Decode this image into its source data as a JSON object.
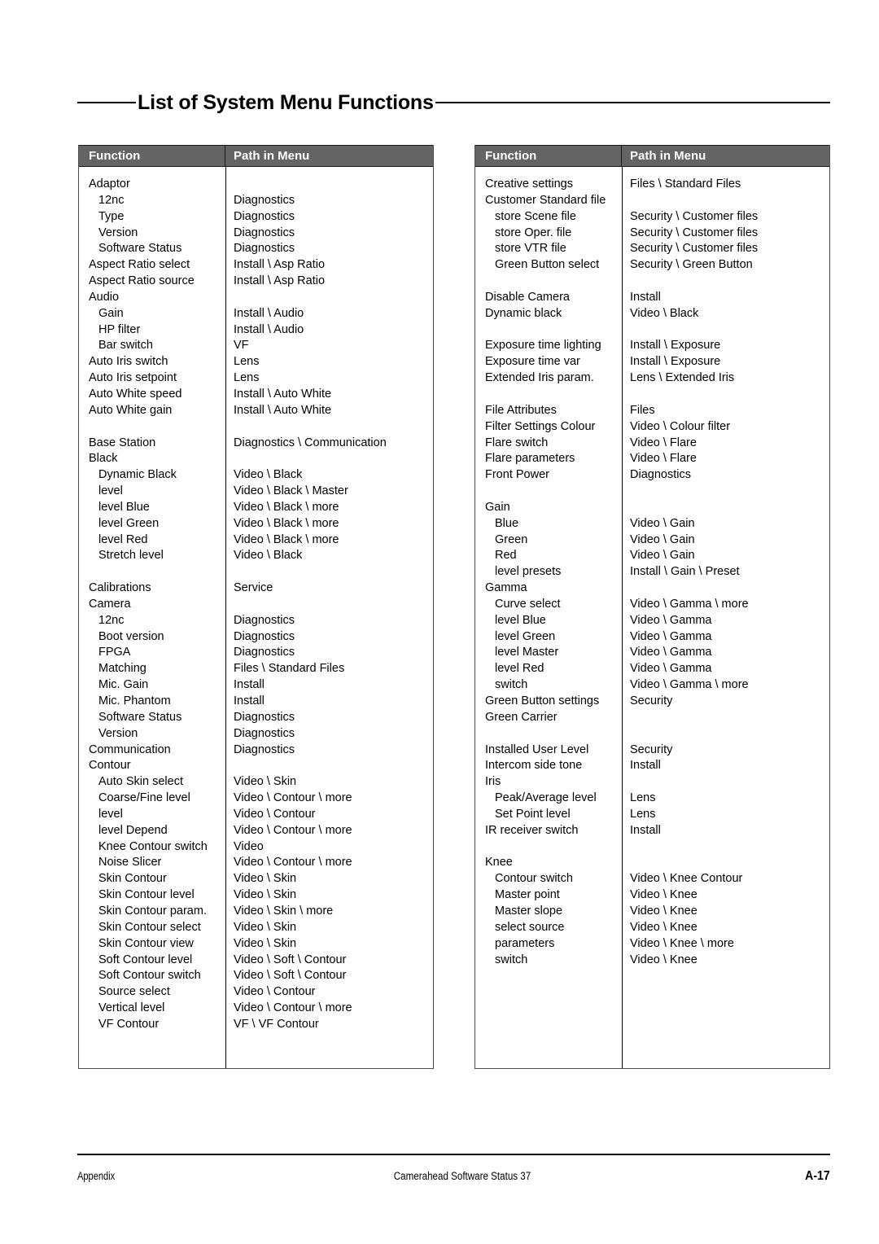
{
  "page": {
    "title": "List of System Menu Functions"
  },
  "table_headers": {
    "function": "Function",
    "path": "Path in Menu"
  },
  "left_table": {
    "rows": [
      {
        "func": "Adaptor",
        "path": "",
        "indent": false
      },
      {
        "func": "12nc",
        "path": "Diagnostics",
        "indent": true
      },
      {
        "func": "Type",
        "path": "Diagnostics",
        "indent": true
      },
      {
        "func": "Version",
        "path": "Diagnostics",
        "indent": true
      },
      {
        "func": "Software Status",
        "path": "Diagnostics",
        "indent": true
      },
      {
        "func": "Aspect Ratio select",
        "path": "Install \\  Asp Ratio",
        "indent": false
      },
      {
        "func": "Aspect Ratio source",
        "path": "Install \\  Asp Ratio",
        "indent": false
      },
      {
        "func": "Audio",
        "path": "",
        "indent": false
      },
      {
        "func": "Gain",
        "path": "Install \\ Audio",
        "indent": true
      },
      {
        "func": "HP filter",
        "path": "Install \\ Audio",
        "indent": true
      },
      {
        "func": "Bar switch",
        "path": "VF",
        "indent": true
      },
      {
        "func": "Auto Iris switch",
        "path": "Lens",
        "indent": false
      },
      {
        "func": "Auto Iris setpoint",
        "path": "Lens",
        "indent": false
      },
      {
        "func": "Auto White speed",
        "path": "Install \\ Auto White",
        "indent": false
      },
      {
        "func": "Auto White gain",
        "path": "Install \\ Auto White",
        "indent": false
      },
      {
        "func": "",
        "path": "",
        "indent": false
      },
      {
        "func": "Base Station",
        "path": "Diagnostics \\ Communication",
        "indent": false
      },
      {
        "func": "Black",
        "path": "",
        "indent": false
      },
      {
        "func": "Dynamic Black",
        "path": "Video \\ Black",
        "indent": true
      },
      {
        "func": "level",
        "path": "Video \\ Black \\ Master",
        "indent": true
      },
      {
        "func": "level Blue",
        "path": "Video \\ Black \\ more",
        "indent": true
      },
      {
        "func": "level Green",
        "path": "Video \\ Black \\ more",
        "indent": true
      },
      {
        "func": "level Red",
        "path": "Video \\ Black \\ more",
        "indent": true
      },
      {
        "func": "Stretch level",
        "path": "Video \\ Black",
        "indent": true
      },
      {
        "func": "",
        "path": "",
        "indent": false
      },
      {
        "func": "Calibrations",
        "path": "Service",
        "indent": false
      },
      {
        "func": "Camera",
        "path": "",
        "indent": false
      },
      {
        "func": "12nc",
        "path": "Diagnostics",
        "indent": true
      },
      {
        "func": "Boot version",
        "path": "Diagnostics",
        "indent": true
      },
      {
        "func": "FPGA",
        "path": "Diagnostics",
        "indent": true
      },
      {
        "func": "Matching",
        "path": "Files \\ Standard Files",
        "indent": true
      },
      {
        "func": "Mic. Gain",
        "path": "Install",
        "indent": true
      },
      {
        "func": "Mic. Phantom",
        "path": "Install",
        "indent": true
      },
      {
        "func": "Software Status",
        "path": "Diagnostics",
        "indent": true
      },
      {
        "func": "Version",
        "path": "Diagnostics",
        "indent": true
      },
      {
        "func": "Communication",
        "path": "Diagnostics",
        "indent": false
      },
      {
        "func": "Contour",
        "path": "",
        "indent": false
      },
      {
        "func": "Auto Skin select",
        "path": "Video \\ Skin",
        "indent": true
      },
      {
        "func": "Coarse/Fine level",
        "path": "Video \\ Contour \\ more",
        "indent": true
      },
      {
        "func": "level",
        "path": "Video \\ Contour",
        "indent": true
      },
      {
        "func": "level Depend",
        "path": "Video \\ Contour \\ more",
        "indent": true
      },
      {
        "func": "Knee Contour switch",
        "path": "Video",
        "indent": true
      },
      {
        "func": "Noise Slicer",
        "path": "Video \\ Contour \\ more",
        "indent": true
      },
      {
        "func": "Skin Contour",
        "path": "Video \\ Skin",
        "indent": true
      },
      {
        "func": "Skin Contour level",
        "path": "Video \\ Skin",
        "indent": true
      },
      {
        "func": "Skin Contour param.",
        "path": "Video \\ Skin \\ more",
        "indent": true
      },
      {
        "func": "Skin Contour select",
        "path": "Video \\ Skin",
        "indent": true
      },
      {
        "func": "Skin Contour view",
        "path": "Video \\ Skin",
        "indent": true
      },
      {
        "func": "Soft Contour level",
        "path": "Video \\ Soft \\ Contour",
        "indent": true
      },
      {
        "func": "Soft Contour switch",
        "path": "Video \\ Soft \\ Contour",
        "indent": true
      },
      {
        "func": "Source select",
        "path": "Video \\ Contour",
        "indent": true
      },
      {
        "func": "Vertical level",
        "path": "Video \\ Contour \\ more",
        "indent": true
      },
      {
        "func": "VF Contour",
        "path": "VF \\ VF Contour",
        "indent": true
      }
    ]
  },
  "right_table": {
    "rows": [
      {
        "func": "Creative settings",
        "path": "Files \\ Standard Files",
        "indent": false
      },
      {
        "func": "Customer Standard file",
        "path": "",
        "indent": false
      },
      {
        "func": "store Scene file",
        "path": "Security \\ Customer files",
        "indent": true
      },
      {
        "func": "store Oper. file",
        "path": "Security \\ Customer files",
        "indent": true
      },
      {
        "func": "store VTR file",
        "path": "Security \\ Customer files",
        "indent": true
      },
      {
        "func": "Green Button select",
        "path": "Security \\ Green Button",
        "indent": true
      },
      {
        "func": "",
        "path": "",
        "indent": false
      },
      {
        "func": "Disable Camera",
        "path": "Install",
        "indent": false
      },
      {
        "func": "Dynamic black",
        "path": "Video \\ Black",
        "indent": false
      },
      {
        "func": "",
        "path": "",
        "indent": false
      },
      {
        "func": "Exposure time lighting",
        "path": "Install \\ Exposure",
        "indent": false
      },
      {
        "func": "Exposure time var",
        "path": "Install \\ Exposure",
        "indent": false
      },
      {
        "func": "Extended Iris param.",
        "path": "Lens \\ Extended Iris",
        "indent": false
      },
      {
        "func": "",
        "path": "",
        "indent": false
      },
      {
        "func": "File Attributes",
        "path": "Files",
        "indent": false
      },
      {
        "func": "Filter Settings Colour",
        "path": "Video \\ Colour filter",
        "indent": false
      },
      {
        "func": "Flare switch",
        "path": "Video \\ Flare",
        "indent": false
      },
      {
        "func": "Flare parameters",
        "path": "Video \\ Flare",
        "indent": false
      },
      {
        "func": "Front Power",
        "path": "Diagnostics",
        "indent": false
      },
      {
        "func": "",
        "path": "",
        "indent": false
      },
      {
        "func": "Gain",
        "path": "",
        "indent": false
      },
      {
        "func": "Blue",
        "path": "Video \\ Gain",
        "indent": true
      },
      {
        "func": "Green",
        "path": "Video \\ Gain",
        "indent": true
      },
      {
        "func": "Red",
        "path": "Video \\ Gain",
        "indent": true
      },
      {
        "func": "level presets",
        "path": "Install \\ Gain \\ Preset",
        "indent": true
      },
      {
        "func": "Gamma",
        "path": "",
        "indent": false
      },
      {
        "func": "Curve select",
        "path": "Video \\ Gamma \\ more",
        "indent": true
      },
      {
        "func": "level Blue",
        "path": "Video \\ Gamma",
        "indent": true
      },
      {
        "func": "level Green",
        "path": "Video \\ Gamma",
        "indent": true
      },
      {
        "func": "level Master",
        "path": "Video \\ Gamma",
        "indent": true
      },
      {
        "func": "level Red",
        "path": "Video \\ Gamma",
        "indent": true
      },
      {
        "func": "switch",
        "path": "Video \\ Gamma \\ more",
        "indent": true
      },
      {
        "func": "Green Button settings",
        "path": "Security",
        "indent": false
      },
      {
        "func": "Green Carrier",
        "path": "",
        "indent": false
      },
      {
        "func": "",
        "path": "",
        "indent": false
      },
      {
        "func": "Installed User Level",
        "path": "Security",
        "indent": false
      },
      {
        "func": "Intercom side tone",
        "path": "Install",
        "indent": false
      },
      {
        "func": "Iris",
        "path": "",
        "indent": false
      },
      {
        "func": "Peak/Average level",
        "path": "Lens",
        "indent": true
      },
      {
        "func": "Set Point level",
        "path": "Lens",
        "indent": true
      },
      {
        "func": "IR receiver switch",
        "path": "Install",
        "indent": false
      },
      {
        "func": "",
        "path": "",
        "indent": false
      },
      {
        "func": "Knee",
        "path": "",
        "indent": false
      },
      {
        "func": "Contour switch",
        "path": "Video \\ Knee Contour",
        "indent": true
      },
      {
        "func": "Master point",
        "path": "Video \\ Knee",
        "indent": true
      },
      {
        "func": "Master slope",
        "path": "Video \\ Knee",
        "indent": true
      },
      {
        "func": "select source",
        "path": "Video \\ Knee",
        "indent": true
      },
      {
        "func": "parameters",
        "path": "Video \\ Knee \\ more",
        "indent": true
      },
      {
        "func": "switch",
        "path": "Video \\ Knee",
        "indent": true
      }
    ]
  },
  "footer": {
    "left": "Appendix",
    "center": "Camerahead Software Status 37",
    "right": "A-17"
  },
  "colors": {
    "header_bg": "#646464",
    "header_text": "#ffffff",
    "border": "#4d4d4d",
    "text": "#000000"
  }
}
